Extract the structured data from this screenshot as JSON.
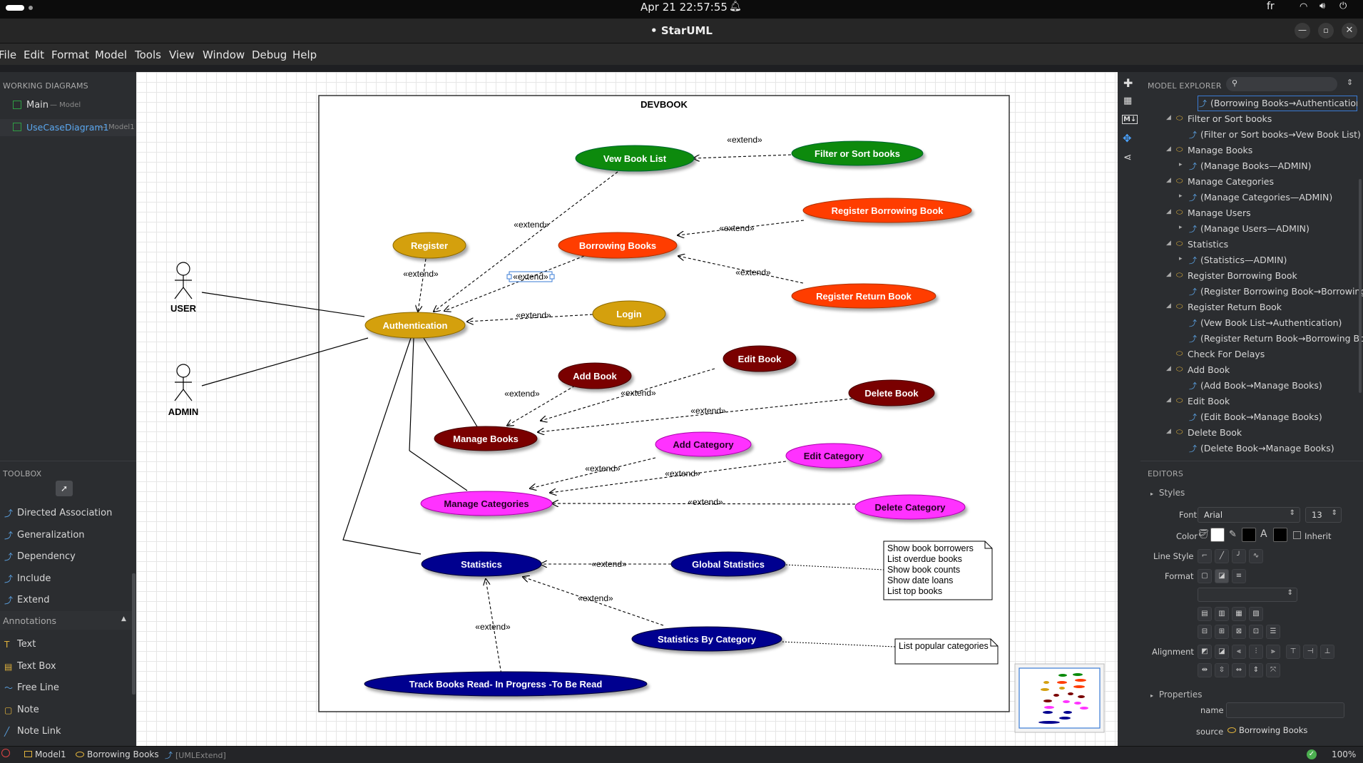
{
  "system_bar": {
    "datetime": "Apr 21  22:57:55",
    "lang": "fr"
  },
  "window": {
    "title": "• StarUML"
  },
  "menu": [
    "File",
    "Edit",
    "Format",
    "Model",
    "Tools",
    "View",
    "Window",
    "Debug",
    "Help"
  ],
  "working_diagrams": {
    "header": "WORKING DIAGRAMS",
    "items": [
      {
        "label": "Main",
        "sub": "— Model"
      },
      {
        "label": "UseCaseDiagram1",
        "sub": "— Model1"
      }
    ]
  },
  "toolbox": {
    "header": "TOOLBOX",
    "items": [
      "Directed Association",
      "Generalization",
      "Dependency",
      "Include",
      "Extend"
    ],
    "annotations_header": "Annotations",
    "annotations": [
      "Text",
      "Text Box",
      "Free Line",
      "Note",
      "Note Link"
    ]
  },
  "diagram": {
    "frame_title": "DEVBOOK",
    "actors": {
      "user": "USER",
      "admin": "ADMIN"
    },
    "use_cases": {
      "vew_book_list": "Vew Book List",
      "filter_sort": "Filter or Sort books",
      "register_borrowing": "Register Borrowing Book",
      "register": "Register",
      "borrowing_books": "Borrowing Books",
      "register_return": "Register Return Book",
      "authentication": "Authentication",
      "login": "Login",
      "edit_book": "Edit Book",
      "add_book": "Add Book",
      "delete_book": "Delete Book",
      "manage_books": "Manage Books",
      "add_category": "Add Category",
      "edit_category": "Edit Category",
      "manage_categories": "Manage Categories",
      "delete_category": "Delete Category",
      "statistics": "Statistics",
      "global_statistics": "Global Statistics",
      "statistics_by_category": "Statistics By Category",
      "track_books": "Track Books Read- In Progress -To Be Read"
    },
    "extend_label": "«extend»",
    "notes": {
      "stats_lines": [
        "Show book borrowers",
        "List overdue books",
        "Show book counts",
        "Show date loans",
        "List top books"
      ],
      "category_note": "List popular categories"
    },
    "colors": {
      "green": "#0a8a0a",
      "orange_red": "#ff3d05",
      "gold": "#d4a010",
      "dark_red": "#7a0000",
      "magenta": "#ff33ff",
      "navy": "#00008f"
    }
  },
  "model_explorer": {
    "header": "MODEL EXPLORER",
    "rows": [
      {
        "label": "(Borrowing Books→Authentication)",
        "type": "rel",
        "indent": 2,
        "selected": true
      },
      {
        "label": "Filter or Sort books",
        "type": "uc",
        "indent": 1,
        "twisty": "◢"
      },
      {
        "label": "(Filter or Sort books→Vew Book List)",
        "type": "rel",
        "indent": 2
      },
      {
        "label": "Manage Books",
        "type": "uc",
        "indent": 1,
        "twisty": "◢"
      },
      {
        "label": "(Manage Books—ADMIN)",
        "type": "rel",
        "indent": 2,
        "twisty": "▸"
      },
      {
        "label": "Manage Categories",
        "type": "uc",
        "indent": 1,
        "twisty": "◢"
      },
      {
        "label": "(Manage Categories—ADMIN)",
        "type": "rel",
        "indent": 2,
        "twisty": "▸"
      },
      {
        "label": "Manage Users",
        "type": "uc",
        "indent": 1,
        "twisty": "◢"
      },
      {
        "label": "(Manage Users—ADMIN)",
        "type": "rel",
        "indent": 2,
        "twisty": "▸"
      },
      {
        "label": "Statistics",
        "type": "uc",
        "indent": 1,
        "twisty": "◢"
      },
      {
        "label": "(Statistics—ADMIN)",
        "type": "rel",
        "indent": 2,
        "twisty": "▸"
      },
      {
        "label": "Register Borrowing Book",
        "type": "uc",
        "indent": 1,
        "twisty": "◢"
      },
      {
        "label": "(Register Borrowing Book→Borrowing",
        "type": "rel",
        "indent": 2
      },
      {
        "label": "Register Return Book",
        "type": "uc",
        "indent": 1,
        "twisty": "◢"
      },
      {
        "label": "(Vew Book List→Authentication)",
        "type": "rel",
        "indent": 2
      },
      {
        "label": "(Register Return Book→Borrowing Boo",
        "type": "rel",
        "indent": 2
      },
      {
        "label": "Check For Delays",
        "type": "uc",
        "indent": 1
      },
      {
        "label": "Add Book",
        "type": "uc",
        "indent": 1,
        "twisty": "◢"
      },
      {
        "label": "(Add Book→Manage Books)",
        "type": "rel",
        "indent": 2
      },
      {
        "label": "Edit Book",
        "type": "uc",
        "indent": 1,
        "twisty": "◢"
      },
      {
        "label": "(Edit Book→Manage Books)",
        "type": "rel",
        "indent": 2
      },
      {
        "label": "Delete Book",
        "type": "uc",
        "indent": 1,
        "twisty": "◢"
      },
      {
        "label": "(Delete Book→Manage Books)",
        "type": "rel",
        "indent": 2
      }
    ]
  },
  "editors": {
    "header": "EDITORS",
    "styles": "Styles",
    "font_label": "Font",
    "font_value": "Arial",
    "font_size": "13",
    "color_label": "Color",
    "inherit_label": "Inherit",
    "line_style_label": "Line Style",
    "format_label": "Format",
    "alignment_label": "Alignment",
    "properties": "Properties",
    "name_label": "name",
    "source_label": "source",
    "source_value": "Borrowing Books"
  },
  "statusbar": {
    "model": "Model1",
    "element": "Borrowing Books",
    "type": "[UMLExtend]",
    "zoom": "100%"
  }
}
